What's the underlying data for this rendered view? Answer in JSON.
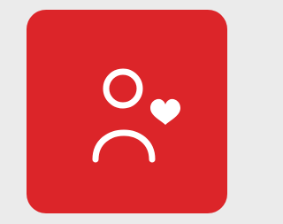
{
  "tile": {
    "icon": "user-heart-icon",
    "background_color": "#dc2529",
    "icon_color": "#ffffff"
  },
  "page": {
    "background_color": "#ebebeb"
  }
}
